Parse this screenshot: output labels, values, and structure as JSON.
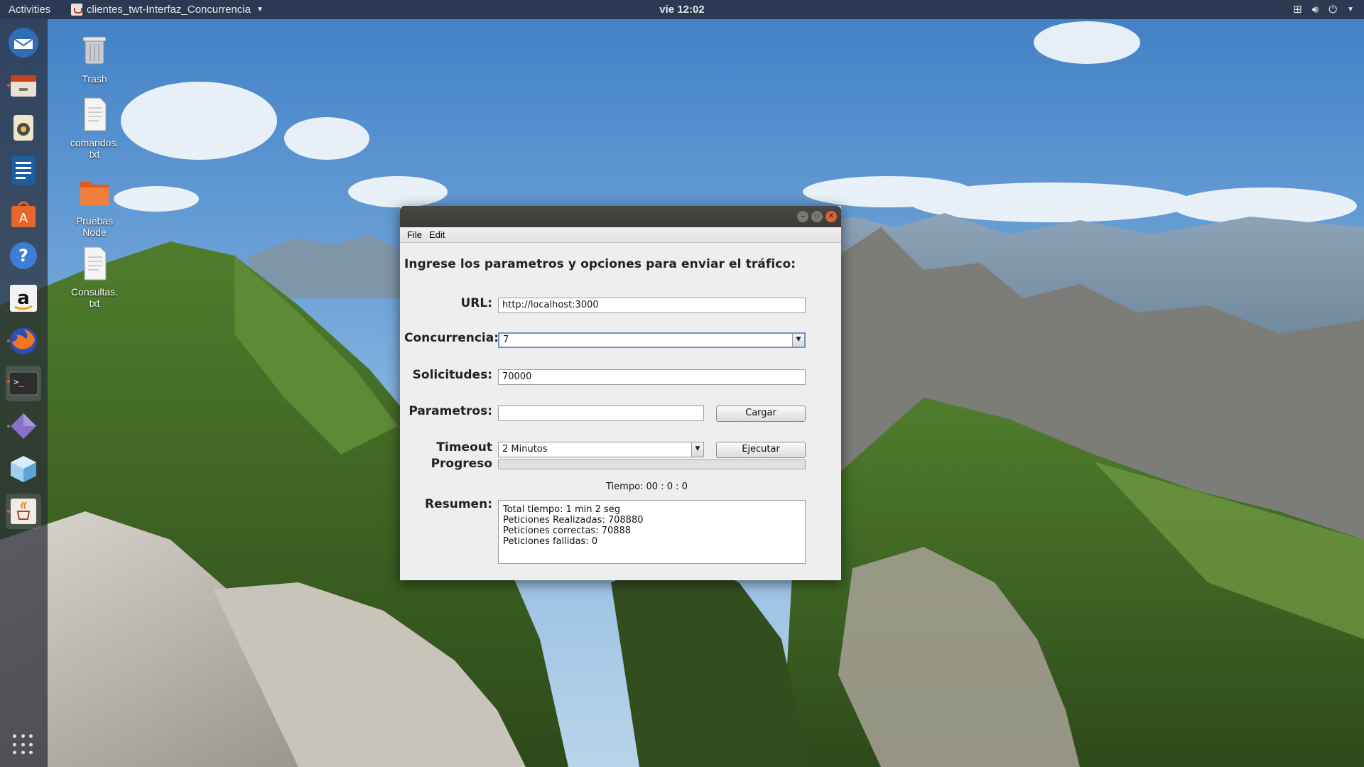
{
  "topbar": {
    "activities": "Activities",
    "app_name": "clientes_twt-Interfaz_Concurrencia",
    "clock": "vie 12:02"
  },
  "desktop": {
    "icons": [
      {
        "label": "Trash"
      },
      {
        "label": "comandos.\ntxt"
      },
      {
        "label": "Pruebas\nNode"
      },
      {
        "label": "Consultas.\ntxt"
      }
    ]
  },
  "window": {
    "menu": {
      "file": "File",
      "edit": "Edit"
    },
    "heading": "Ingrese los parametros y opciones para enviar el tráfico:",
    "url": {
      "label": "URL:",
      "value": "http://localhost:3000"
    },
    "concurrencia": {
      "label": "Concurrencia:",
      "value": "7"
    },
    "solicitudes": {
      "label": "Solicitudes:",
      "value": "70000"
    },
    "parametros": {
      "label": "Parametros:",
      "value": "",
      "button": "Cargar"
    },
    "timeout": {
      "label": "Timeout",
      "value": "2 Minutos",
      "button": "Ejecutar"
    },
    "progreso": {
      "label": "Progreso",
      "fraction": 0
    },
    "tiempo": "Tiempo:  00  :  0  :  0",
    "resumen": {
      "label": "Resumen:",
      "lines": [
        "Total tiempo: 1 min 2 seg",
        "Peticiones Realizadas: 708880",
        "Peticiones correctas: 70888",
        "Peticiones fallidas: 0"
      ]
    }
  }
}
